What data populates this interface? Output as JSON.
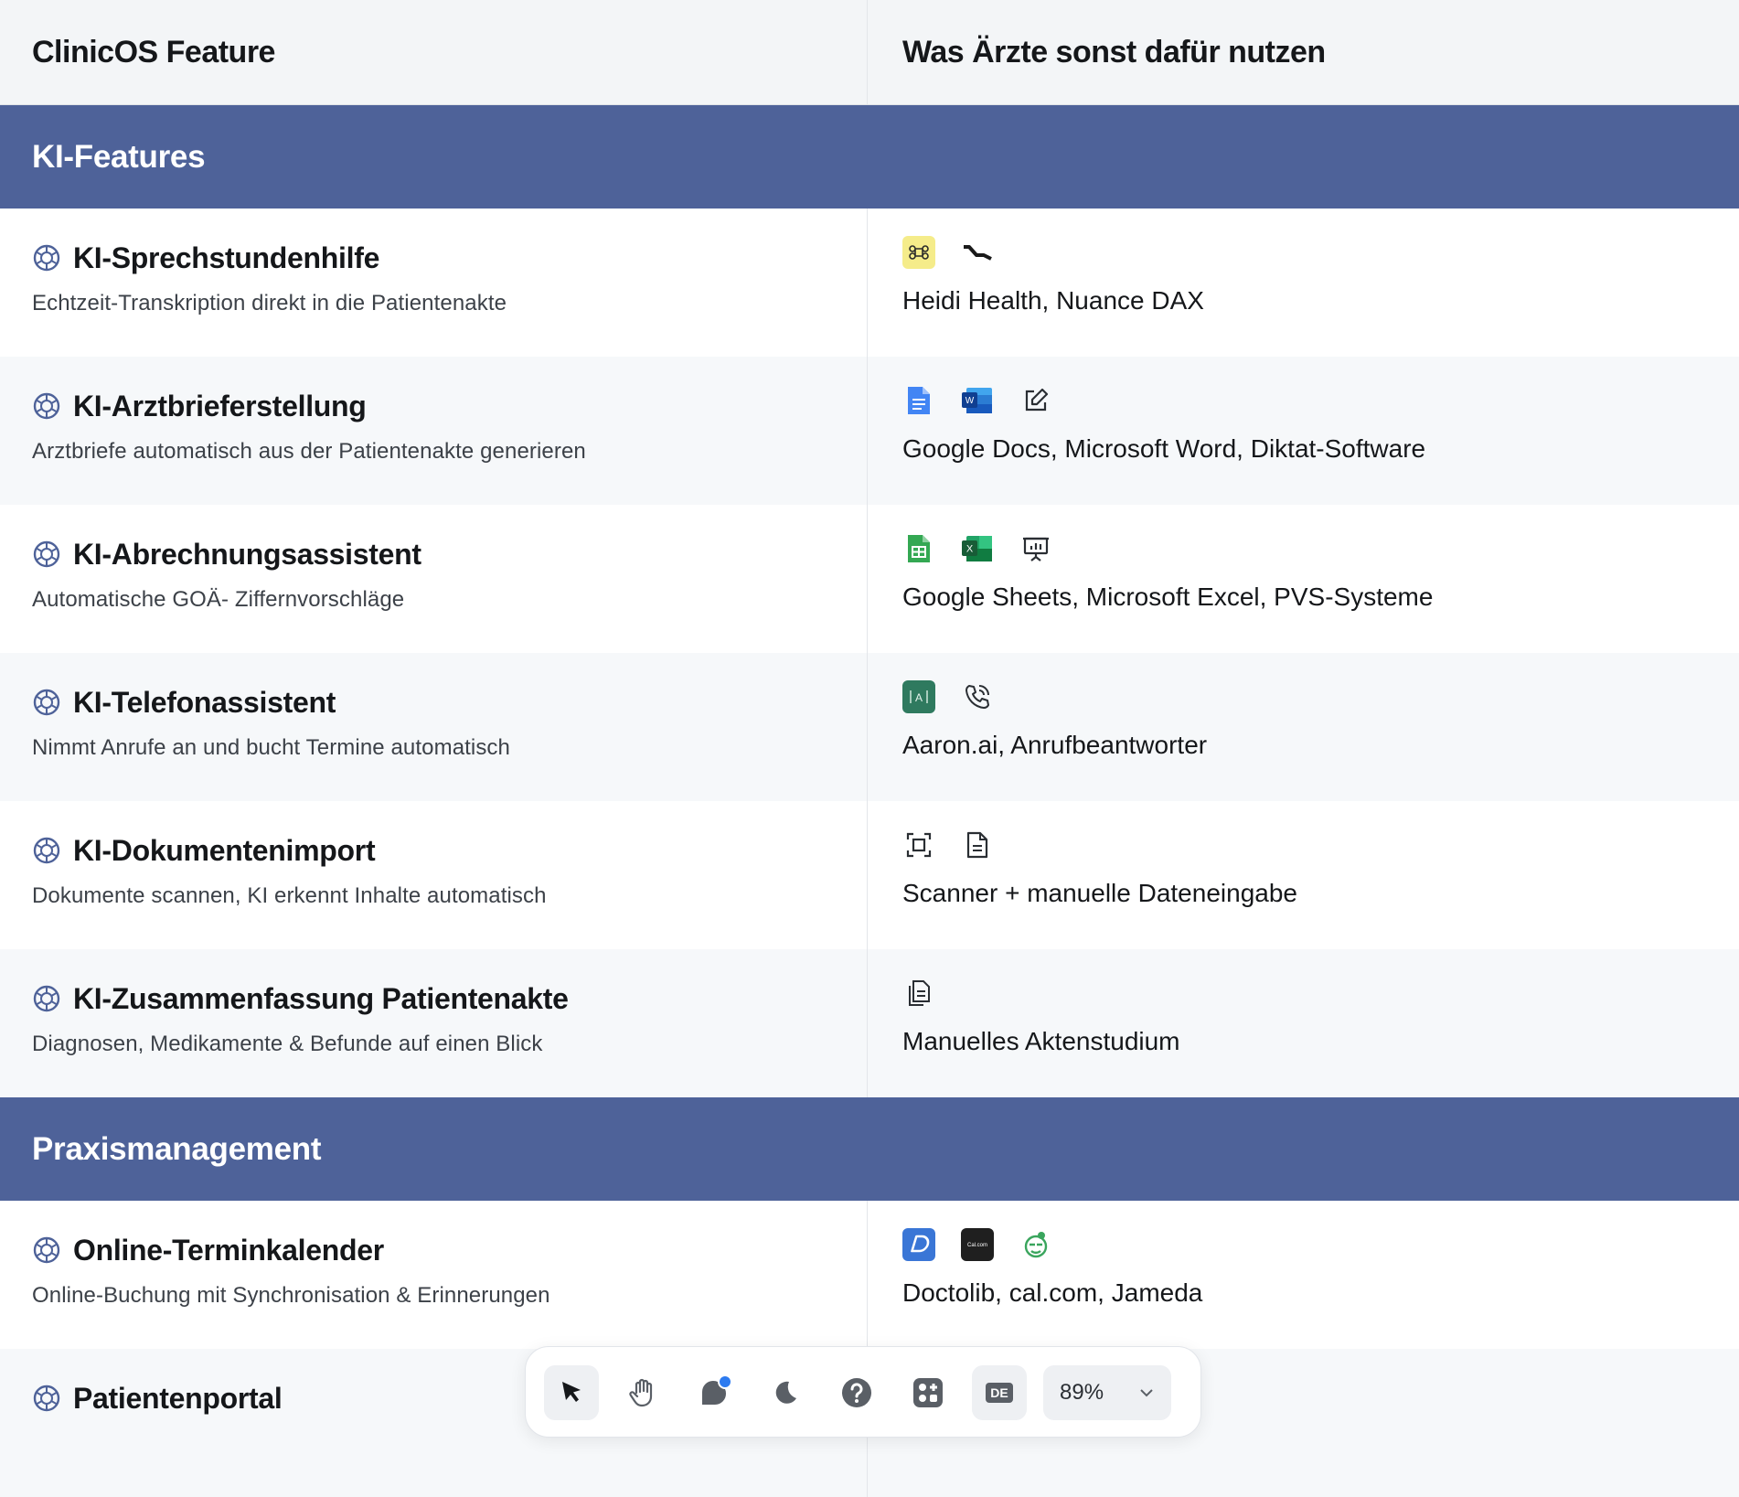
{
  "header": {
    "left": "ClinicOS Feature",
    "right": "Was Ärzte sonst dafür nutzen"
  },
  "sections": [
    {
      "title": "KI-Features",
      "features": [
        {
          "title": "KI-Sprechstundenhilfe",
          "desc": "Echtzeit-Transkription direkt in die  Patientenakte",
          "tools": "Heidi Health, Nuance DAX",
          "icons": [
            "heidi-health-icon",
            "nuance-dax-icon"
          ]
        },
        {
          "title": "KI-Arztbrieferstellung",
          "desc": "Arztbriefe automatisch aus der  Patientenakte generieren",
          "tools": "Google Docs, Microsoft Word, Diktat-Software",
          "icons": [
            "google-docs-icon",
            "microsoft-word-icon",
            "edit-icon"
          ]
        },
        {
          "title": "KI-Abrechnungsassistent",
          "desc": "Automatische GOÄ-  Ziffernvorschläge",
          "tools": "Google Sheets, Microsoft Excel, PVS-Systeme",
          "icons": [
            "google-sheets-icon",
            "microsoft-excel-icon",
            "presentation-chart-icon"
          ]
        },
        {
          "title": "KI-Telefonassistent",
          "desc": "Nimmt Anrufe an und bucht Termine automatisch",
          "tools": "Aaron.ai, Anrufbeantworter",
          "icons": [
            "aaron-ai-icon",
            "phone-icon"
          ]
        },
        {
          "title": "KI-Dokumentenimport",
          "desc": "Dokumente scannen, KI erkennt Inhalte automatisch",
          "tools": "Scanner + manuelle Dateneingabe",
          "icons": [
            "scan-icon",
            "document-icon"
          ]
        },
        {
          "title": "KI-Zusammenfassung Patientenakte",
          "desc": "Diagnosen, Medikamente & Befunde auf einen Blick",
          "tools": "Manuelles Aktenstudium",
          "icons": [
            "documents-icon"
          ]
        }
      ]
    },
    {
      "title": "Praxismanagement",
      "features": [
        {
          "title": "Online-Terminkalender",
          "desc": "Online-Buchung mit Synchronisation & Erinnerungen",
          "tools": "Doctolib, cal.com, Jameda",
          "icons": [
            "doctolib-icon",
            "cal-com-icon",
            "jameda-icon"
          ]
        },
        {
          "title": "Patientenportal",
          "desc": "",
          "tools": "",
          "icons": []
        }
      ]
    }
  ],
  "toolbar": {
    "zoom": "89%",
    "lang": "DE",
    "buttons": [
      "select-tool",
      "hand-tool",
      "shapes-tool",
      "dark-mode",
      "help",
      "apps",
      "language",
      "zoom"
    ]
  },
  "colors": {
    "section_bg": "#4e6299",
    "brain_icon": "#4e6299",
    "alt_row_bg": "#f6f8fa",
    "header_bg": "#f3f5f7",
    "notification_dot": "#2d7bf0"
  }
}
